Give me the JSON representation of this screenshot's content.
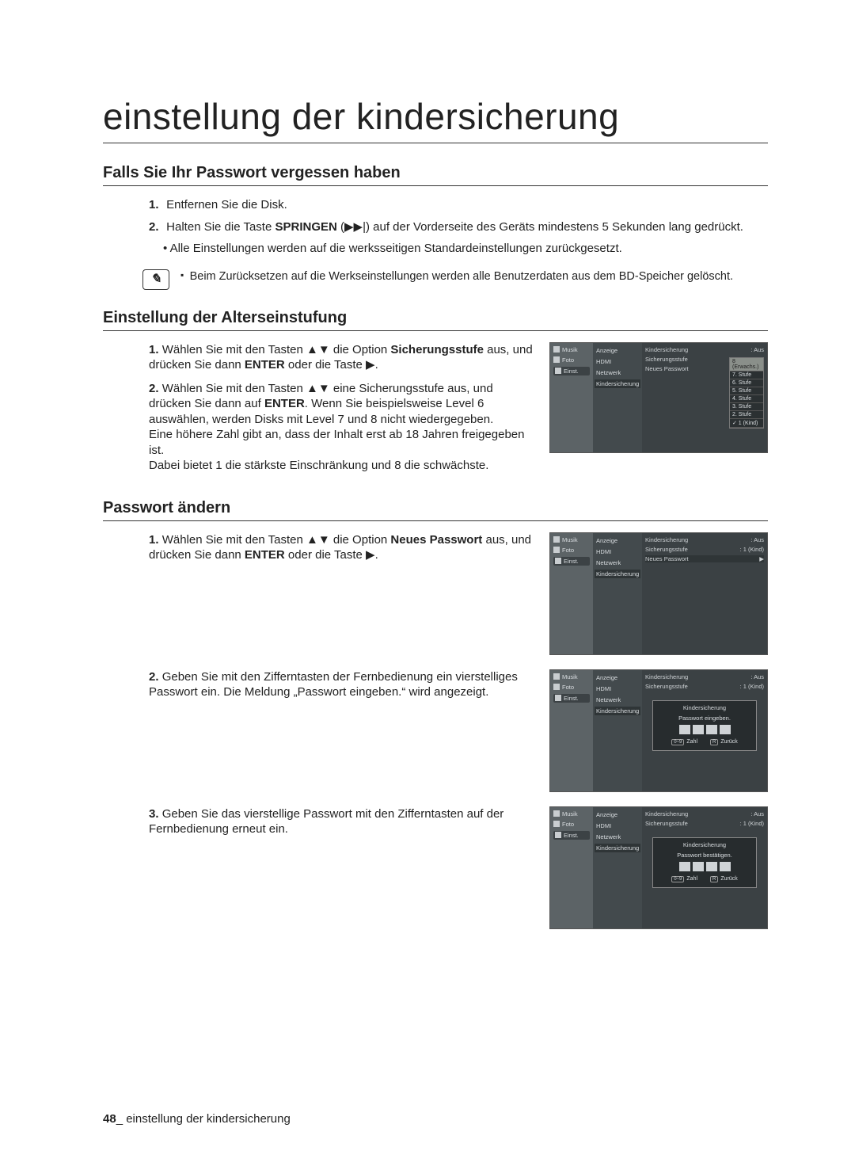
{
  "title": "einstellung der kindersicherung",
  "sec1": {
    "heading": "Falls Sie Ihr Passwort vergessen haben",
    "step1": "Entfernen Sie die Disk.",
    "step2_a": "Halten Sie die Taste ",
    "step2_b_bold": "SPRINGEN",
    "step2_c": " (▶▶|) auf der Vorderseite des Geräts mindestens 5 Sekunden lang gedrückt.",
    "bullet1": "Alle Einstellungen werden auf die werksseitigen Standardeinstellungen zurückgesetzt.",
    "note": "Beim Zurücksetzen auf die Werkseinstellungen werden alle Benutzerdaten aus dem BD-Speicher gelöscht."
  },
  "sec2": {
    "heading": "Einstellung der Alterseinstufung",
    "s1a": "Wählen Sie mit den Tasten ▲▼ die Option ",
    "s1b_bold": "Sicherungsstufe",
    "s1c": " aus, und drücken Sie dann ",
    "s1d_bold": "ENTER",
    "s1e": " oder die Taste ▶.",
    "s2a": "Wählen Sie mit den Tasten ▲▼ eine Sicherungsstufe aus, und drücken Sie dann auf ",
    "s2b_bold": "ENTER",
    "s2c": ". Wenn Sie beispielsweise Level 6 auswählen, werden Disks mit Level 7 und 8 nicht wiedergegeben.",
    "s2d": "Eine höhere Zahl gibt an, dass der Inhalt erst ab 18 Jahren freigegeben ist.",
    "s2e": "Dabei bietet 1 die stärkste Einschränkung und 8 die schwächste."
  },
  "sec3": {
    "heading": "Passwort ändern",
    "s1a": "Wählen Sie mit den Tasten ▲▼ die Option ",
    "s1b_bold": "Neues Passwort",
    "s1c": " aus, und drücken Sie dann ",
    "s1d_bold": "ENTER",
    "s1e": " oder die Taste ▶.",
    "s2": "Geben Sie mit den Zifferntasten der Fernbedienung ein vierstelliges Passwort ein. Die Meldung „Passwort eingeben.“ wird angezeigt.",
    "s3": "Geben Sie das vierstellige Passwort mit den Zifferntasten auf der Fernbedienung erneut ein."
  },
  "osd": {
    "sb_music": "Musik",
    "sb_foto": "Foto",
    "sb_einst": "Einst.",
    "mid_anzeige": "Anzeige",
    "mid_hdmi": "HDMI",
    "mid_netzwerk": "Netzwerk",
    "mid_kinder": "Kindersicherung",
    "r_kinder": "Kindersicherung",
    "r_kinder_v": ": Aus",
    "r_stufe": "Sicherungsstufe",
    "r_stufe_v1": ": 1 (Kind)",
    "r_neupw": "Neues Passwort",
    "pop8": "8 (Erwachs.)",
    "pop7": "7. Stufe",
    "pop6": "6. Stufe",
    "pop5": "5. Stufe",
    "pop4": "4. Stufe",
    "pop3": "3. Stufe",
    "pop2": "2. Stufe",
    "pop1": "✓ 1 (Kind)",
    "ov_title1": "Kindersicherung",
    "ov_enter": "Passwort eingeben.",
    "ov_confirm": "Passwort bestätigen.",
    "ov_zahl": "Zahl",
    "ov_back": "Zurück",
    "key09": "0~9",
    "keyR": "R"
  },
  "footer": {
    "page": "48",
    "sep": "_ ",
    "text": "einstellung der kindersicherung"
  }
}
